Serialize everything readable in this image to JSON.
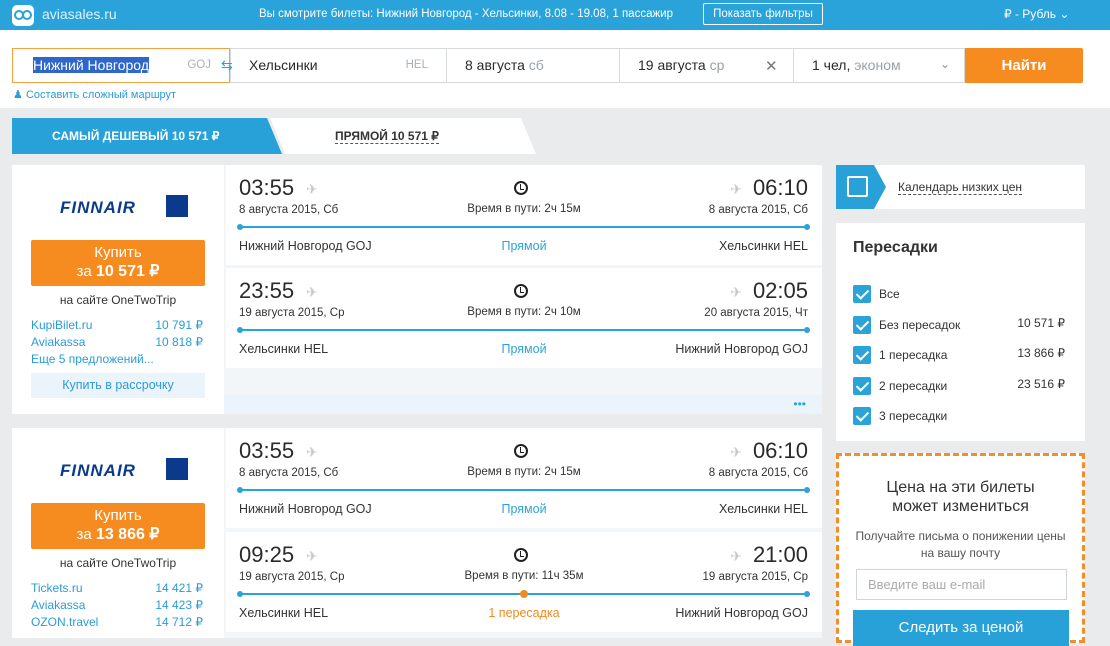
{
  "header": {
    "logo_text": "aviasales.ru",
    "message": "Вы смотрите билеты: Нижний Новгород - Хельсинки, 8.08 - 19.08, 1 пассажир",
    "filters_button": "Показать фильтры",
    "currency": "₽ - Рубль"
  },
  "search": {
    "from_city": "Нижний Новгород",
    "from_code": "GOJ",
    "to_city": "Хельсинки",
    "to_code": "HEL",
    "depart_date": "8 августа",
    "depart_dow": "сб",
    "return_date": "19 августа",
    "return_dow": "ср",
    "pax": "1 чел,",
    "cabin": "эконом",
    "find_button": "Найти",
    "complex_route": "Составить сложный маршрут"
  },
  "tabs": {
    "cheapest": "САМЫЙ ДЕШЕВЫЙ 10 571 ₽",
    "direct": "ПРЯМОЙ 10 571 ₽"
  },
  "results": [
    {
      "airline": "FINNAIR",
      "buy_label": "Купить",
      "buy_price_prefix": "за",
      "buy_price": "10 571 ₽",
      "site": "на сайте OneTwoTrip",
      "offers": [
        {
          "name": "KupiBilet.ru",
          "price": "10 791 ₽"
        },
        {
          "name": "Aviakassa",
          "price": "10 818 ₽"
        }
      ],
      "more": "Еще 5 предложений...",
      "installment": "Купить в рассрочку",
      "segments": [
        {
          "dep_time": "03:55",
          "dep_date": "8 августа 2015, Сб",
          "arr_time": "06:10",
          "arr_date": "8 августа 2015, Сб",
          "duration": "Время в пути: 2ч 15м",
          "from": "Нижний Новгород GOJ",
          "to": "Хельсинки HEL",
          "stops": "Прямой"
        },
        {
          "dep_time": "23:55",
          "dep_date": "19 августа 2015, Ср",
          "arr_time": "02:05",
          "arr_date": "20 августа 2015, Чт",
          "duration": "Время в пути: 2ч 10м",
          "from": "Хельсинки HEL",
          "to": "Нижний Новгород GOJ",
          "stops": "Прямой"
        }
      ]
    },
    {
      "airline": "FINNAIR",
      "buy_label": "Купить",
      "buy_price_prefix": "за",
      "buy_price": "13 866 ₽",
      "site": "на сайте OneTwoTrip",
      "offers": [
        {
          "name": "Tickets.ru",
          "price": "14 421 ₽"
        },
        {
          "name": "Aviakassa",
          "price": "14 423 ₽"
        },
        {
          "name": "OZON.travel",
          "price": "14 712 ₽"
        }
      ],
      "segments": [
        {
          "dep_time": "03:55",
          "dep_date": "8 августа 2015, Сб",
          "arr_time": "06:10",
          "arr_date": "8 августа 2015, Сб",
          "duration": "Время в пути: 2ч 15м",
          "from": "Нижний Новгород GOJ",
          "to": "Хельсинки HEL",
          "stops": "Прямой"
        },
        {
          "dep_time": "09:25",
          "dep_date": "19 августа 2015, Ср",
          "arr_time": "21:00",
          "arr_date": "19 августа 2015, Ср",
          "duration": "Время в пути: 11ч 35м",
          "from": "Хельсинки HEL",
          "to": "Нижний Новгород GOJ",
          "stops": "1 пересадка"
        }
      ]
    }
  ],
  "sidebar": {
    "calendar_link": "Календарь низких цен",
    "transfers_title": "Пересадки",
    "transfers": [
      {
        "label": "Все",
        "price": "",
        "checked": true
      },
      {
        "label": "Без пересадок",
        "price": "10 571 ₽",
        "checked": true
      },
      {
        "label": "1 пересадка",
        "price": "13 866 ₽",
        "checked": true
      },
      {
        "label": "2 пересадки",
        "price": "23 516 ₽",
        "checked": true
      },
      {
        "label": "3 пересадки",
        "price": "",
        "checked": true
      }
    ],
    "promo_title": "Цена на эти билеты может измениться",
    "promo_text": "Получайте письма о понижении цены на вашу почту",
    "email_placeholder": "Введите ваш e-mail",
    "follow_button": "Следить за ценой"
  },
  "colors": {
    "brand_blue": "#29a3d9",
    "accent_orange": "#f68b1f",
    "airline_blue": "#0a3a8c"
  }
}
